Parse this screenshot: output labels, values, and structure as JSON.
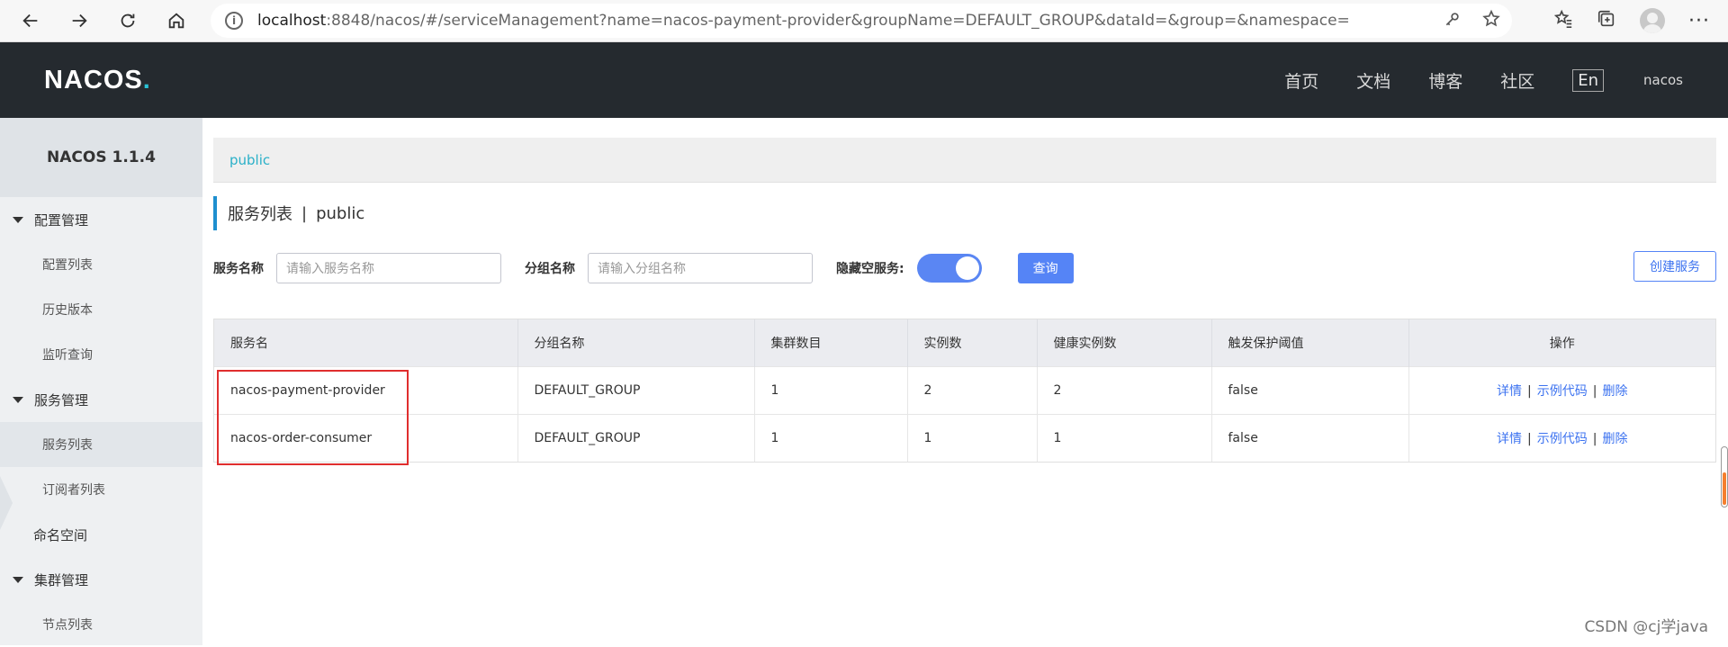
{
  "browser": {
    "url_host": "localhost",
    "url_rest": ":8848/nacos/#/serviceManagement?name=nacos-payment-provider&groupName=DEFAULT_GROUP&dataId=&group=&namespace="
  },
  "header": {
    "logo": "NACOS",
    "logo_dot": ".",
    "nav": [
      "首页",
      "文档",
      "博客",
      "社区"
    ],
    "lang": "En",
    "user": "nacos"
  },
  "sidebar": {
    "version": "NACOS 1.1.4",
    "groups": [
      {
        "label": "配置管理",
        "items": [
          "配置列表",
          "历史版本",
          "监听查询"
        ]
      },
      {
        "label": "服务管理",
        "items": [
          "服务列表",
          "订阅者列表"
        ]
      }
    ],
    "namespace": "命名空间",
    "cluster": {
      "label": "集群管理",
      "items": [
        "节点列表"
      ]
    }
  },
  "main": {
    "namespace_tab": "public",
    "title": "服务列表",
    "title_sep": "|",
    "title_ns": "public",
    "filters": {
      "service_label": "服务名称",
      "service_placeholder": "请输入服务名称",
      "group_label": "分组名称",
      "group_placeholder": "请输入分组名称",
      "hide_empty_label": "隐藏空服务:",
      "hide_empty_on": true,
      "query_button": "查询",
      "create_button": "创建服务"
    },
    "table": {
      "headers": [
        "服务名",
        "分组名称",
        "集群数目",
        "实例数",
        "健康实例数",
        "触发保护阈值",
        "操作"
      ],
      "rows": [
        {
          "name": "nacos-payment-provider",
          "group": "DEFAULT_GROUP",
          "clusters": "1",
          "instances": "2",
          "healthy": "2",
          "threshold": "false"
        },
        {
          "name": "nacos-order-consumer",
          "group": "DEFAULT_GROUP",
          "clusters": "1",
          "instances": "1",
          "healthy": "1",
          "threshold": "false"
        }
      ],
      "ops": [
        "详情",
        "示例代码",
        "删除"
      ],
      "op_sep": "|"
    }
  },
  "watermark": "CSDN @cj学java",
  "colors": {
    "header_bg": "#252a2f",
    "accent": "#5584f6",
    "highlight": "#e02e2e"
  }
}
